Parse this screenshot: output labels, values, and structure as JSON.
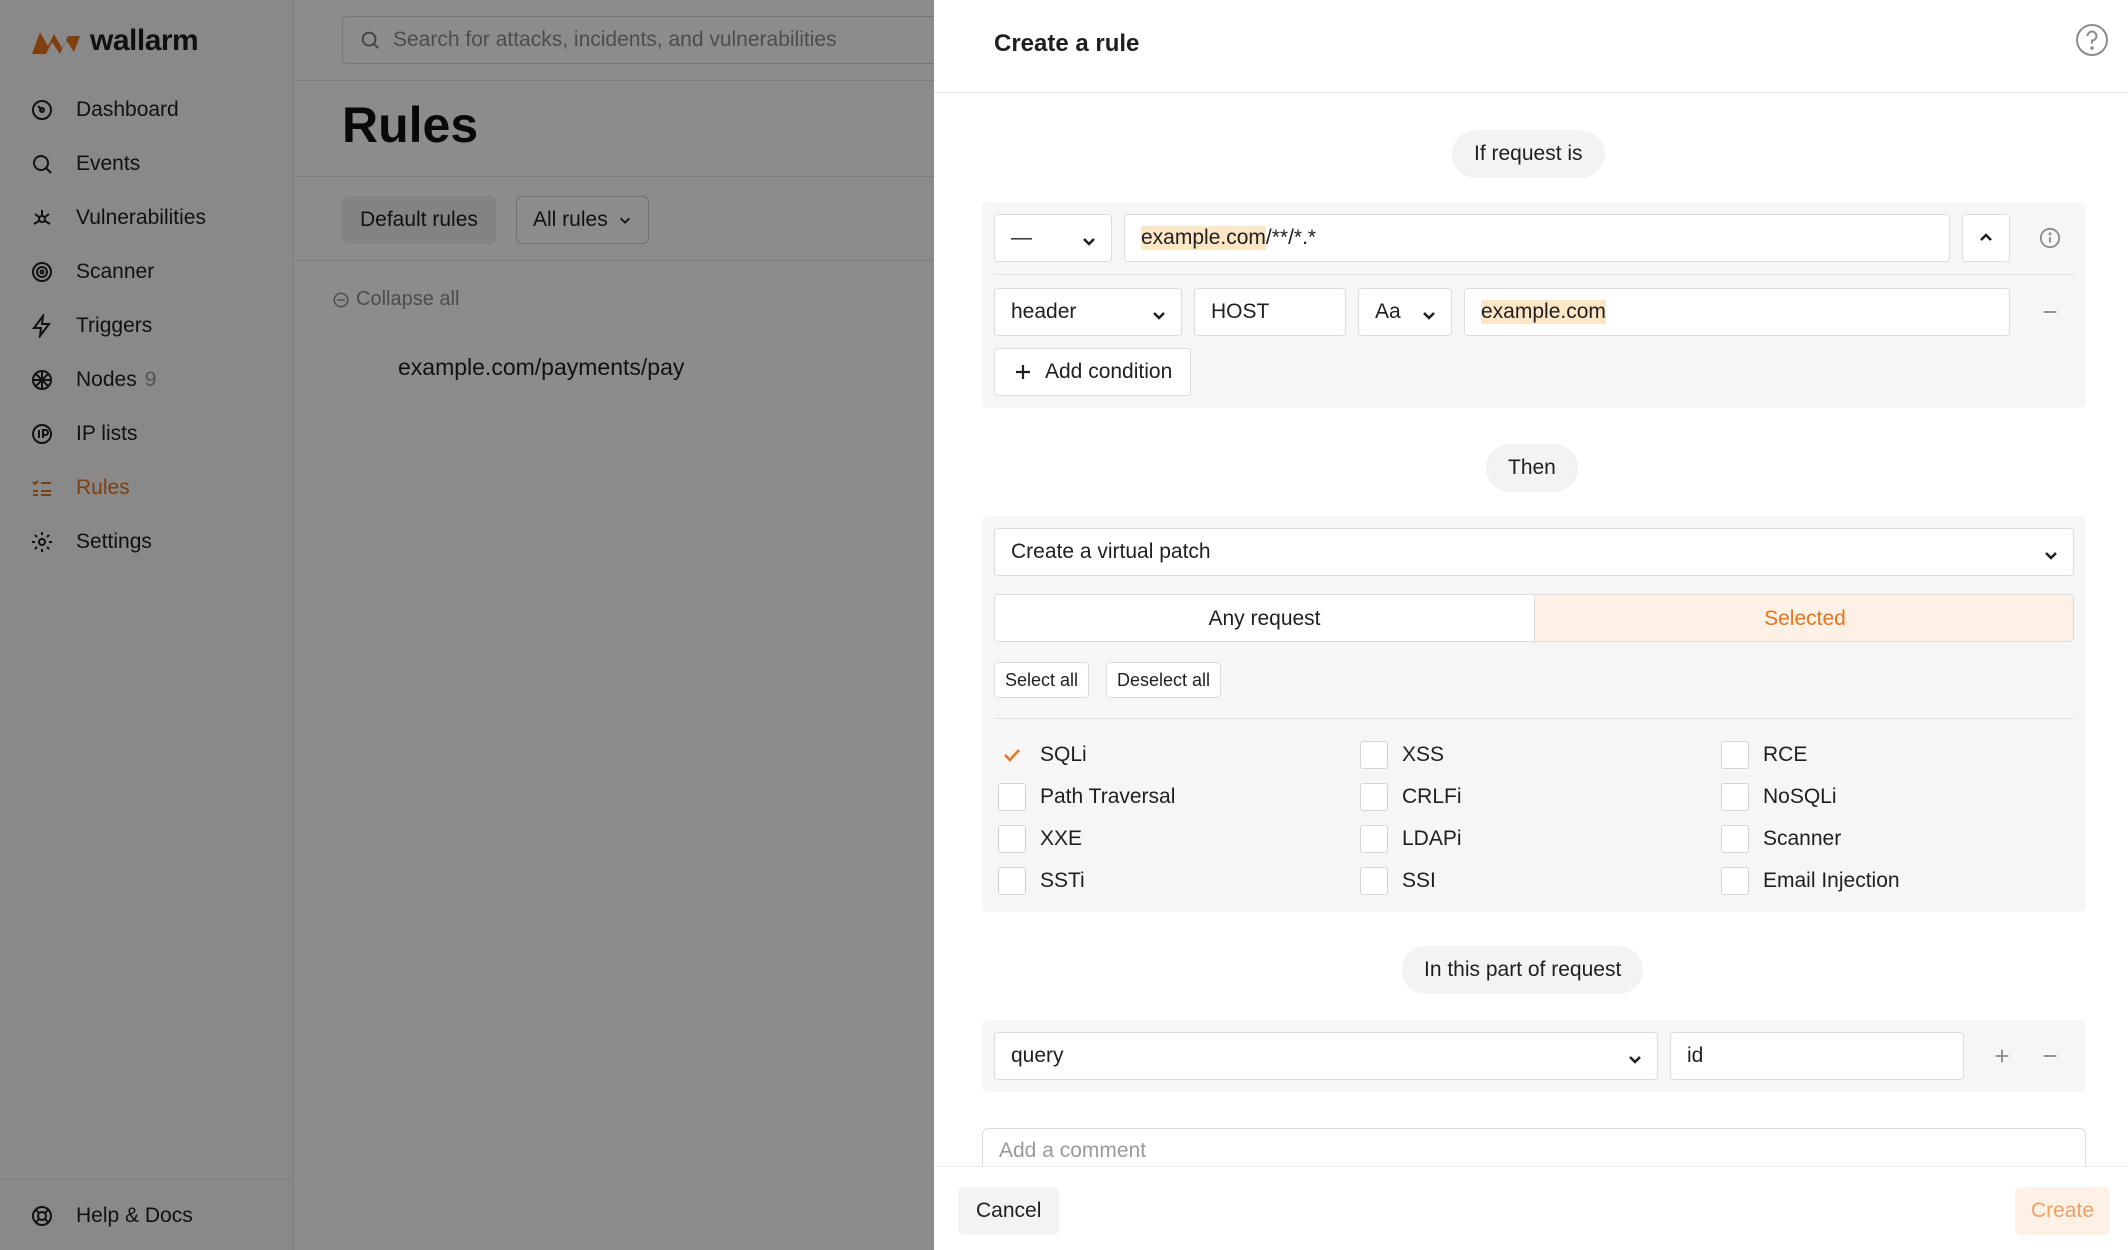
{
  "app": {
    "logo_text": "wallarm"
  },
  "sidebar": {
    "items": [
      {
        "label": "Dashboard",
        "icon": "dashboard-icon"
      },
      {
        "label": "Events",
        "icon": "search-icon"
      },
      {
        "label": "Vulnerabilities",
        "icon": "bug-icon"
      },
      {
        "label": "Scanner",
        "icon": "radar-icon"
      },
      {
        "label": "Triggers",
        "icon": "lightning-icon"
      },
      {
        "label": "Nodes",
        "icon": "nodes-icon",
        "count": "9"
      },
      {
        "label": "IP lists",
        "icon": "ip-icon"
      },
      {
        "label": "Rules",
        "icon": "rules-icon",
        "active": true
      },
      {
        "label": "Settings",
        "icon": "gear-icon"
      }
    ],
    "help": {
      "label": "Help & Docs",
      "icon": "lifebuoy-icon"
    },
    "accent_color": "#e8741c"
  },
  "main": {
    "search_placeholder": "Search for attacks, incidents, and vulnerabilities",
    "title": "Rules",
    "default_rules_label": "Default rules",
    "all_rules_label": "All rules",
    "collapse_all_label": "Collapse all",
    "rule_path": "example.com/payments/pay"
  },
  "drawer": {
    "title": "Create a rule",
    "if_label": "If request is",
    "condition_row1": {
      "method": "—",
      "path_highlight": "example.com",
      "path_rest": "/**/*.*"
    },
    "condition_row2": {
      "type": "header",
      "name": "HOST",
      "case": "Aa",
      "value": "example.com"
    },
    "add_condition_label": "Add condition",
    "then_label": "Then",
    "action": "Create a virtual patch",
    "segment": {
      "any": "Any request",
      "selected": "Selected"
    },
    "select_all_label": "Select all",
    "deselect_all_label": "Deselect all",
    "attack_types": [
      {
        "label": "SQLi",
        "checked": true
      },
      {
        "label": "XSS",
        "checked": false
      },
      {
        "label": "RCE",
        "checked": false
      },
      {
        "label": "Path Traversal",
        "checked": false
      },
      {
        "label": "CRLFi",
        "checked": false
      },
      {
        "label": "NoSQLi",
        "checked": false
      },
      {
        "label": "XXE",
        "checked": false
      },
      {
        "label": "LDAPi",
        "checked": false
      },
      {
        "label": "Scanner",
        "checked": false
      },
      {
        "label": "SSTi",
        "checked": false
      },
      {
        "label": "SSI",
        "checked": false
      },
      {
        "label": "Email Injection",
        "checked": false
      }
    ],
    "part_label": "In this part of request",
    "part": {
      "type": "query",
      "name": "id"
    },
    "comment_placeholder": "Add a comment",
    "cancel_label": "Cancel",
    "create_label": "Create"
  }
}
